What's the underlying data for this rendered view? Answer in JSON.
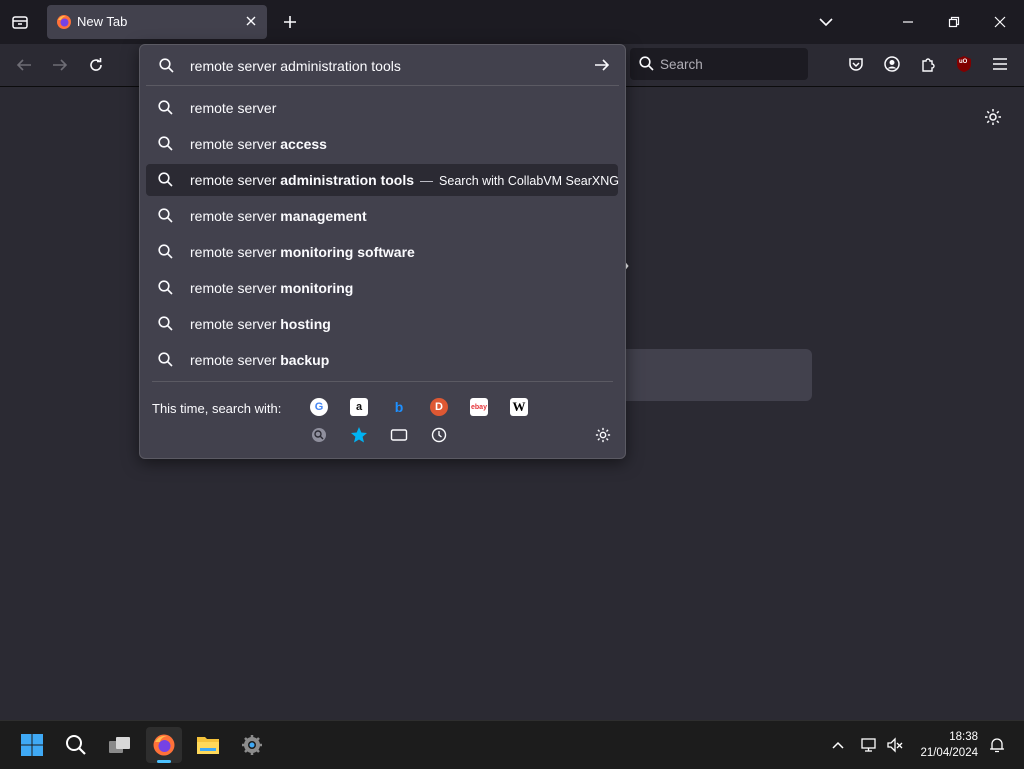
{
  "tab": {
    "title": "New Tab"
  },
  "urlbar": {
    "value": "remote server administration tools"
  },
  "websearch": {
    "placeholder": "Search"
  },
  "suggestions": [
    {
      "prefix": "remote server",
      "bold": ""
    },
    {
      "prefix": "remote server ",
      "bold": "access"
    },
    {
      "prefix": "remote server ",
      "bold": "administration tools",
      "dash": "—",
      "action": "Search with CollabVM SearXNG",
      "selected": true
    },
    {
      "prefix": "remote server ",
      "bold": "management"
    },
    {
      "prefix": "remote server ",
      "bold": "monitoring software"
    },
    {
      "prefix": "remote server ",
      "bold": "monitoring"
    },
    {
      "prefix": "remote server ",
      "bold": "hosting"
    },
    {
      "prefix": "remote server ",
      "bold": "backup"
    }
  ],
  "one_off": {
    "label": "This time, search with:"
  },
  "engines": [
    {
      "name": "google",
      "glyph": "G"
    },
    {
      "name": "amazon",
      "glyph": "a"
    },
    {
      "name": "bing",
      "glyph": "b"
    },
    {
      "name": "duckduckgo",
      "glyph": "D"
    },
    {
      "name": "ebay",
      "glyph": "ebay"
    },
    {
      "name": "wikipedia",
      "glyph": "W"
    }
  ],
  "extension_badge": "uO",
  "clock": {
    "time": "18:38",
    "date": "21/04/2024"
  },
  "colors": {
    "accent": "#00b3f4",
    "bg": "#2b2a33",
    "popup": "#42414d"
  }
}
